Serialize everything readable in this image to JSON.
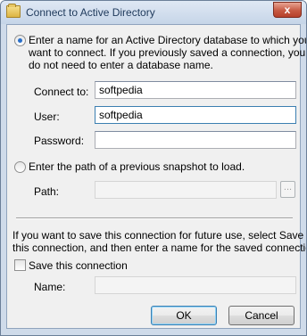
{
  "window": {
    "title": "Connect to Active Directory",
    "close_glyph": "x"
  },
  "options": {
    "database": {
      "label_line1": "Enter a name for an Active Directory database to which you",
      "label_line2": "want to connect. If you previously saved a connection, you",
      "label_line3": "do not need to enter a database name.",
      "selected": true
    },
    "snapshot": {
      "label": "Enter the path of a previous snapshot to load.",
      "selected": false
    }
  },
  "fields": {
    "connect_to": {
      "label": "Connect to:",
      "value": "softpedia"
    },
    "user": {
      "label": "User:",
      "value": "softpedia"
    },
    "password": {
      "label": "Password:",
      "value": ""
    },
    "path": {
      "label": "Path:",
      "value": "",
      "browse_label": "..."
    }
  },
  "save": {
    "info_line1": "If you want to save this connection for future use, select Save",
    "info_line2": "this connection, and then enter a name for the saved connection.",
    "checkbox_label": "Save this connection",
    "checked": false,
    "name_label": "Name:",
    "name_value": ""
  },
  "buttons": {
    "ok": "OK",
    "cancel": "Cancel"
  }
}
